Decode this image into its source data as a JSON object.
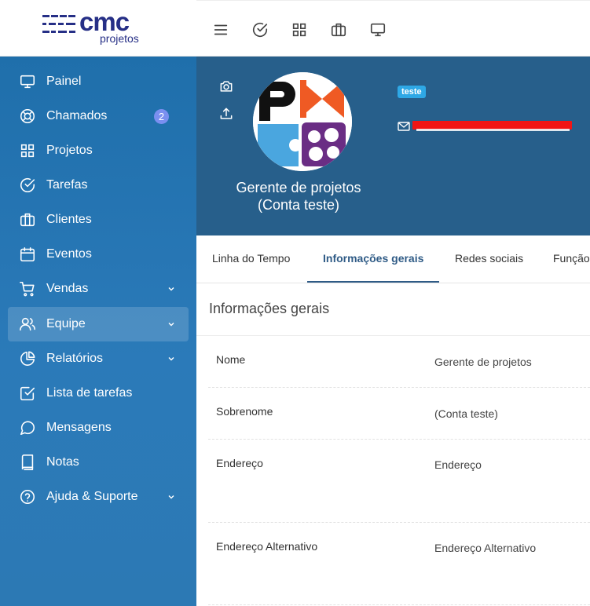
{
  "brand": {
    "logo_text": "cmc",
    "logo_sub": "projetos"
  },
  "toolbar": {
    "icons": [
      "menu-icon",
      "check-circle-icon",
      "grid-icon",
      "briefcase-icon",
      "monitor-icon"
    ]
  },
  "sidebar": {
    "items": [
      {
        "label": "Painel",
        "icon": "monitor-icon"
      },
      {
        "label": "Chamados",
        "icon": "lifebuoy-icon",
        "badge": "2"
      },
      {
        "label": "Projetos",
        "icon": "grid-icon"
      },
      {
        "label": "Tarefas",
        "icon": "check-circle-icon"
      },
      {
        "label": "Clientes",
        "icon": "briefcase-icon"
      },
      {
        "label": "Eventos",
        "icon": "calendar-icon"
      },
      {
        "label": "Vendas",
        "icon": "cart-icon",
        "expandable": true
      },
      {
        "label": "Equipe",
        "icon": "users-icon",
        "expandable": true,
        "active": true
      },
      {
        "label": "Relatórios",
        "icon": "pie-chart-icon",
        "expandable": true
      },
      {
        "label": "Lista de tarefas",
        "icon": "check-square-icon"
      },
      {
        "label": "Mensagens",
        "icon": "message-icon"
      },
      {
        "label": "Notas",
        "icon": "book-icon"
      },
      {
        "label": "Ajuda & Suporte",
        "icon": "help-icon",
        "expandable": true
      }
    ]
  },
  "profile": {
    "name_line1": "Gerente de projetos",
    "name_line2": "(Conta teste)",
    "tag": "teste",
    "email_redacted": true
  },
  "tabs": [
    {
      "label": "Linha do Tempo"
    },
    {
      "label": "Informações gerais",
      "active": true
    },
    {
      "label": "Redes sociais"
    },
    {
      "label": "Função"
    }
  ],
  "info": {
    "title": "Informações gerais",
    "rows": [
      {
        "label": "Nome",
        "value": "Gerente de projetos"
      },
      {
        "label": "Sobrenome",
        "value": "(Conta teste)"
      },
      {
        "label": "Endereço",
        "value": "Endereço"
      },
      {
        "label": "Endereço Alternativo",
        "value": "Endereço Alternativo"
      }
    ]
  },
  "colors": {
    "sidebar": "#2b7ab9",
    "profile_header": "#275f8b",
    "brand": "#262f86",
    "badge": "#7a8ff0",
    "tag": "#2ea8e6",
    "active_tab": "#2f5b86"
  }
}
